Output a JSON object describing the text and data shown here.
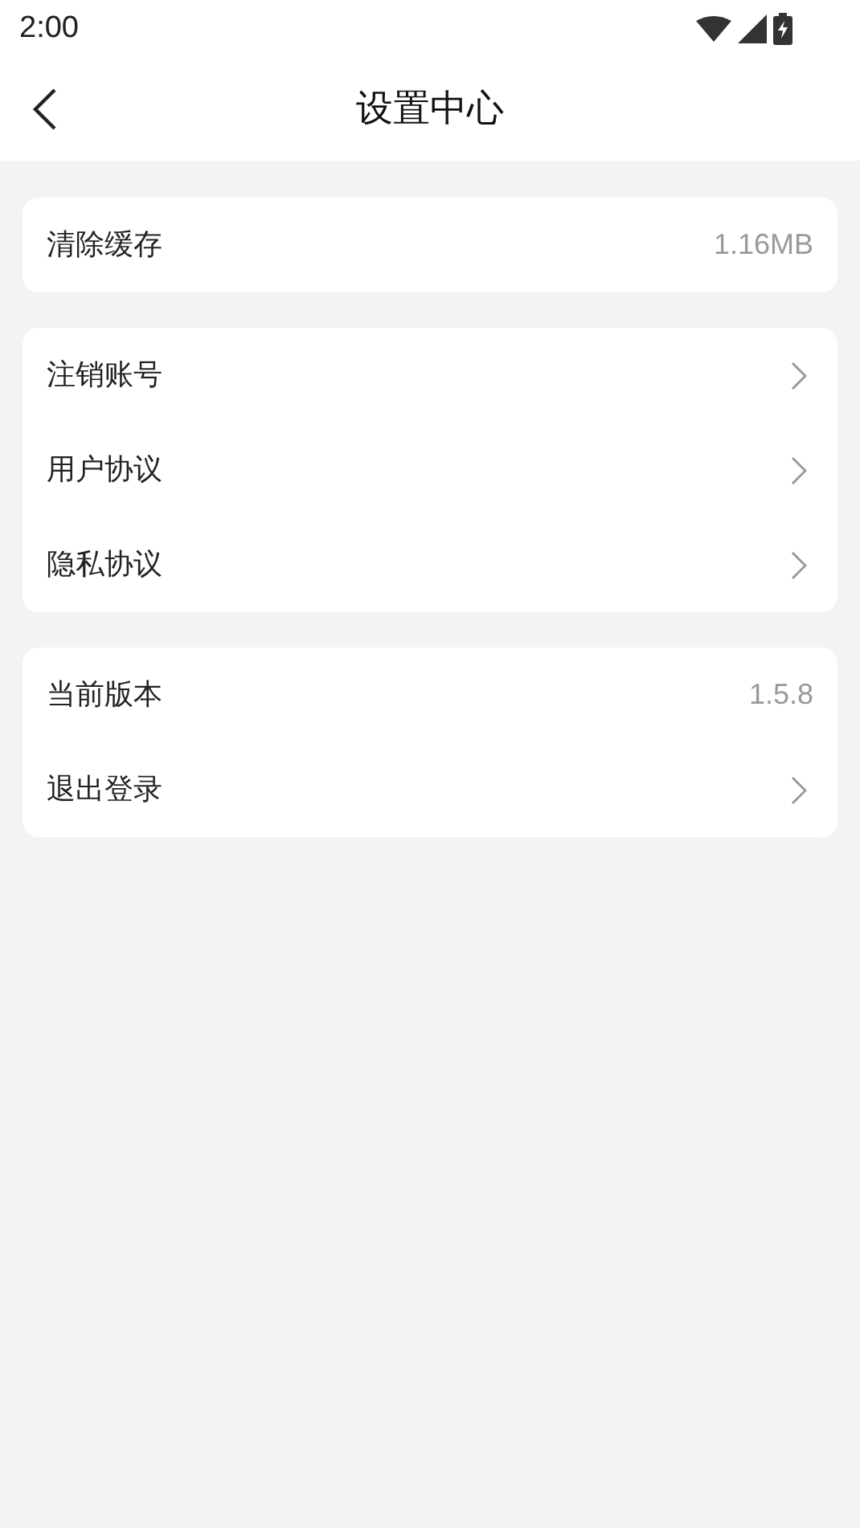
{
  "status_bar": {
    "time": "2:00"
  },
  "header": {
    "title": "设置中心"
  },
  "groups": [
    {
      "rows": [
        {
          "kind": "value",
          "label": "清除缓存",
          "value": "1.16MB"
        }
      ]
    },
    {
      "rows": [
        {
          "kind": "link",
          "label": "注销账号"
        },
        {
          "kind": "link",
          "label": "用户协议"
        },
        {
          "kind": "link",
          "label": "隐私协议"
        }
      ]
    },
    {
      "rows": [
        {
          "kind": "value",
          "label": "当前版本",
          "value": "1.5.8"
        },
        {
          "kind": "link",
          "label": "退出登录"
        }
      ]
    }
  ]
}
